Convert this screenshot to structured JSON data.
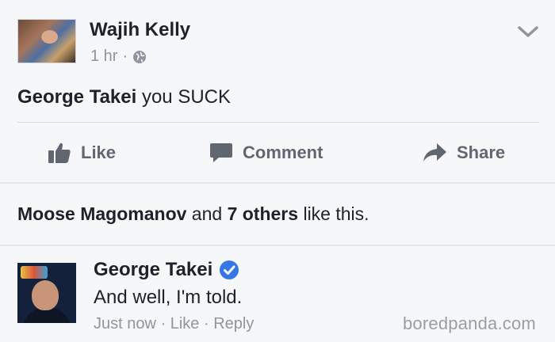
{
  "post": {
    "author": "Wajih Kelly",
    "time": "1 hr",
    "separator": "·",
    "mention": "George Takei",
    "text": " you SUCK"
  },
  "actions": {
    "like": "Like",
    "comment": "Comment",
    "share": "Share"
  },
  "likes": {
    "name": "Moose Magomanov",
    "and": " and ",
    "others": "7 others",
    "suffix": " like this."
  },
  "comment": {
    "author": "George Takei",
    "text": "And well, I'm told.",
    "time": "Just now",
    "dot1": " · ",
    "like": "Like",
    "dot2": " · ",
    "reply": "Reply"
  },
  "watermark": "boredpanda.com",
  "icons": {
    "globe": "globe-icon",
    "chevron": "chevron-down-icon",
    "like": "thumbs-up-icon",
    "comment": "speech-bubble-icon",
    "share": "share-arrow-icon",
    "verified": "verified-badge-icon"
  },
  "colors": {
    "background": "#f6f7f9",
    "text": "#1d2129",
    "muted": "#90949c",
    "action": "#606770",
    "verified": "#3578e5"
  }
}
